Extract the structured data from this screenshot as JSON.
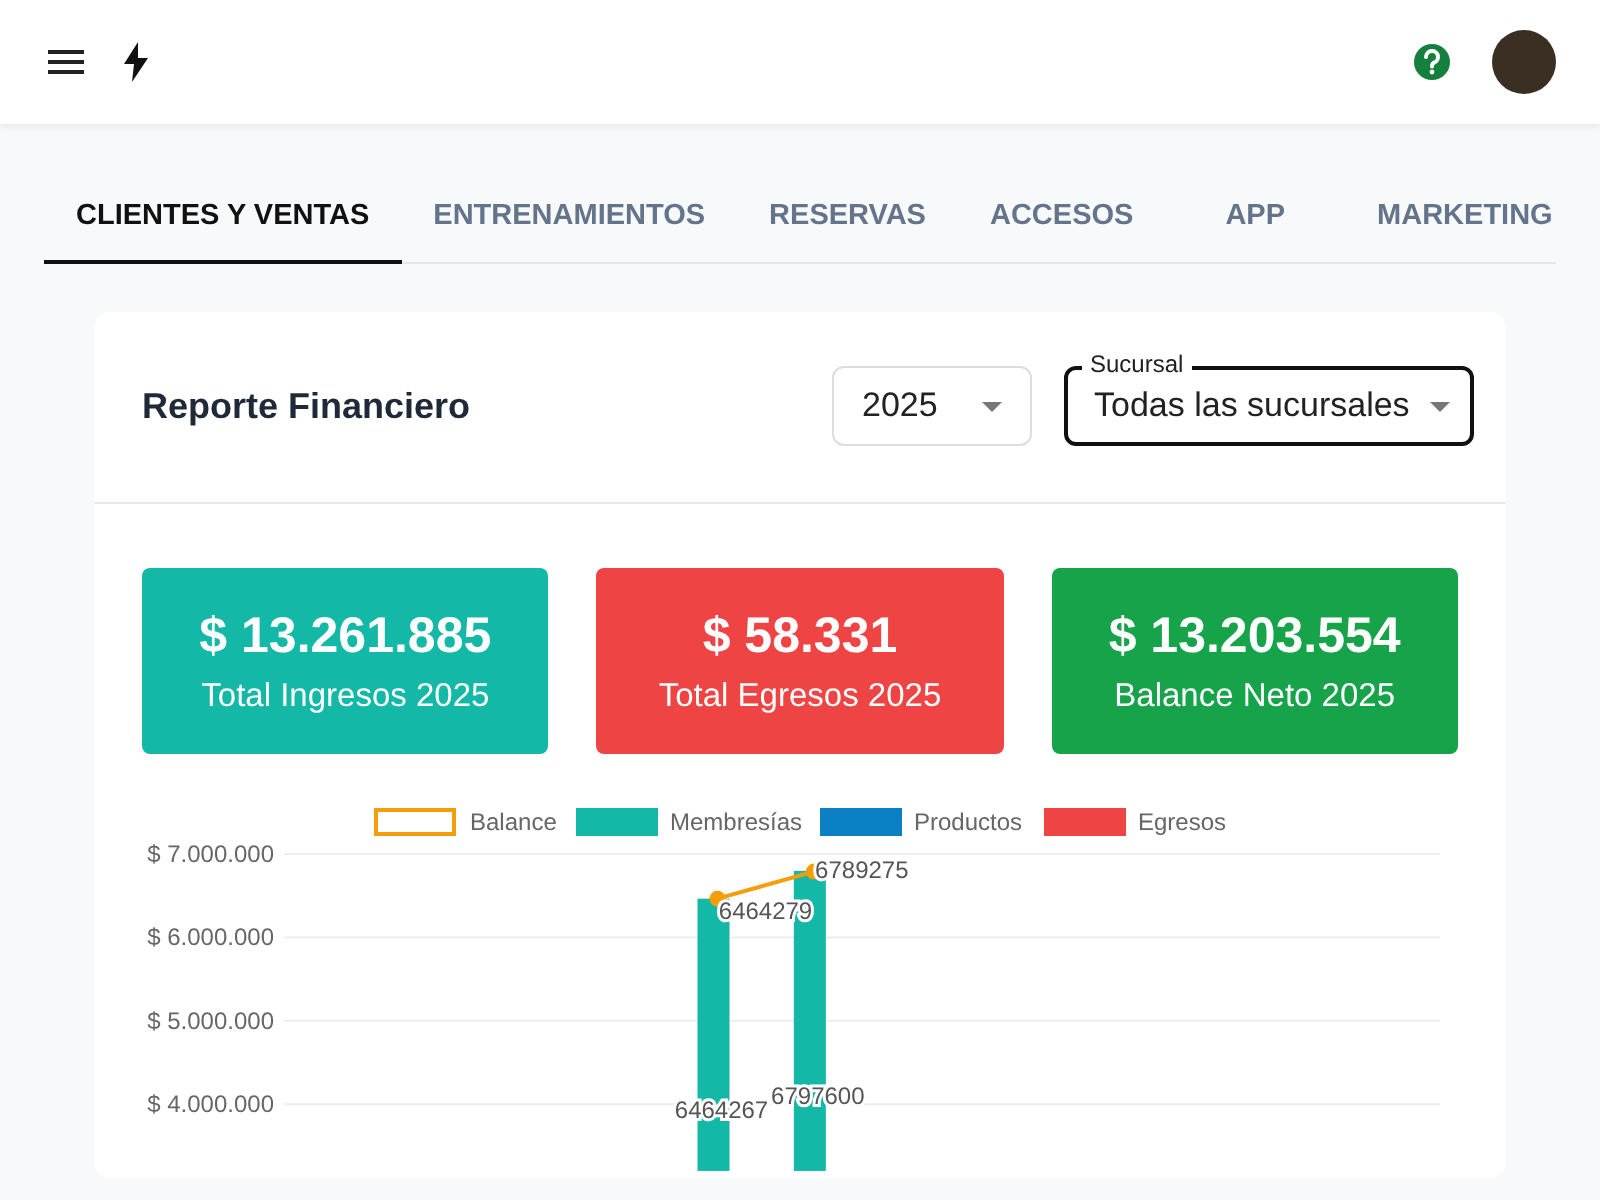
{
  "tabs": [
    {
      "label": "CLIENTES Y VENTAS",
      "selected": true
    },
    {
      "label": "ENTRENAMIENTOS",
      "selected": false
    },
    {
      "label": "RESERVAS",
      "selected": false
    },
    {
      "label": "ACCESOS",
      "selected": false
    },
    {
      "label": "APP",
      "selected": false
    },
    {
      "label": "MARKETING",
      "selected": false
    }
  ],
  "report": {
    "title": "Reporte Financiero",
    "year_select": {
      "value": "2025"
    },
    "branch_select": {
      "label": "Sucursal",
      "value": "Todas las sucursales"
    },
    "stats": [
      {
        "value": "$ 13.261.885",
        "label": "Total Ingresos 2025",
        "color": "#14b8a6"
      },
      {
        "value": "$ 58.331",
        "label": "Total Egresos 2025",
        "color": "#ef4444"
      },
      {
        "value": "$ 13.203.554",
        "label": "Balance Neto 2025",
        "color": "#16a34a"
      }
    ],
    "chart_data": {
      "type": "bar",
      "ylim": [
        3200000,
        7000000
      ],
      "yticks": [
        {
          "value": 4000000,
          "label": "$ 4.000.000"
        },
        {
          "value": 5000000,
          "label": "$ 5.000.000"
        },
        {
          "value": 6000000,
          "label": "$ 6.000.000"
        },
        {
          "value": 7000000,
          "label": "$ 7.000.000"
        }
      ],
      "data_labels": true,
      "grid": true,
      "legend": true,
      "series": [
        {
          "name": "Balance",
          "color": "#f59e0b",
          "type": "line",
          "marker": true,
          "values": [
            null,
            null,
            null,
            null,
            6464279,
            6789275,
            null,
            null,
            null,
            null,
            null,
            null
          ]
        },
        {
          "name": "Membresías",
          "color": "#14b8a6",
          "type": "bar",
          "values": [
            null,
            null,
            null,
            null,
            6464267,
            6797600,
            null,
            null,
            null,
            null,
            null,
            null
          ]
        },
        {
          "name": "Productos",
          "color": "#0a7fc4",
          "type": "bar",
          "values": [
            null,
            null,
            null,
            null,
            null,
            null,
            null,
            null,
            null,
            null,
            null,
            null
          ]
        },
        {
          "name": "Egresos",
          "color": "#ef4444",
          "type": "bar",
          "values": [
            null,
            null,
            null,
            null,
            null,
            null,
            null,
            null,
            null,
            null,
            null,
            null
          ]
        }
      ]
    }
  }
}
